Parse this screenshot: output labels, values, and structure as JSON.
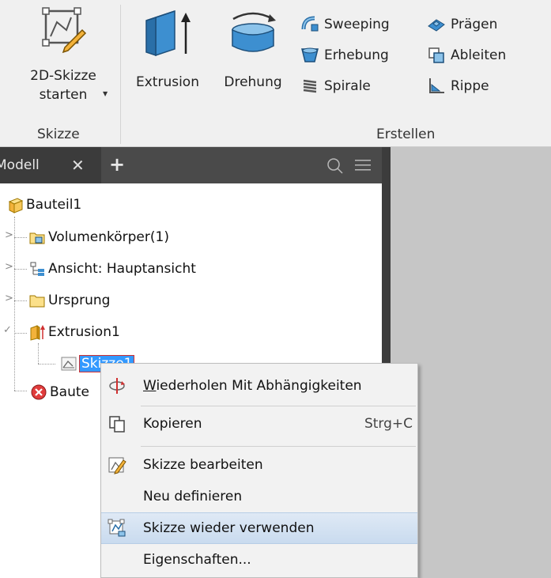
{
  "ribbon": {
    "sketch_button": {
      "line1": "2D-Skizze",
      "line2": "starten",
      "icon": "sketch-2d-icon"
    },
    "extrusion_button": {
      "label": "Extrusion",
      "icon": "extrusion-icon"
    },
    "revolve_button": {
      "label": "Drehung",
      "icon": "revolve-icon"
    },
    "small_buttons": [
      {
        "label": "Sweeping",
        "icon": "sweep-icon"
      },
      {
        "label": "Erhebung",
        "icon": "loft-icon"
      },
      {
        "label": "Spirale",
        "icon": "coil-icon"
      },
      {
        "label": "Prägen",
        "icon": "emboss-icon"
      },
      {
        "label": "Ableiten",
        "icon": "derive-icon"
      },
      {
        "label": "Rippe",
        "icon": "rib-icon"
      }
    ],
    "group_labels": {
      "sketch": "Skizze",
      "create": "Erstellen"
    }
  },
  "browser": {
    "tab_label": "Modell",
    "close_glyph": "✕",
    "add_glyph": "+",
    "tree": {
      "root": "Bauteil1",
      "solid_bodies": "Volumenkörper(1)",
      "view": "Ansicht: Hauptansicht",
      "origin": "Ursprung",
      "extrusion": "Extrusion1",
      "sketch": "Skizze1",
      "end_of_part": "Baute"
    }
  },
  "context_menu": {
    "items": [
      {
        "label": "Wiederholen Mit Abhängigkeiten",
        "shortcut": "",
        "icon": "redo-constraints-icon"
      },
      {
        "label": "Kopieren",
        "shortcut": "Strg+C",
        "icon": "copy-icon"
      },
      {
        "label": "Skizze bearbeiten",
        "shortcut": "",
        "icon": "edit-sketch-icon"
      },
      {
        "label": "Neu definieren",
        "shortcut": "",
        "icon": ""
      },
      {
        "label": "Skizze wieder verwenden",
        "shortcut": "",
        "icon": "reuse-sketch-icon"
      },
      {
        "label": "Eigenschaften...",
        "shortcut": "",
        "icon": ""
      }
    ]
  },
  "colors": {
    "ribbon_bg": "#f0f0f0",
    "panel_header_bg": "#4a4a4a",
    "selection_blue": "#3399ff",
    "menu_highlight": "#c9dbef",
    "workspace_bg": "#c6c6c6"
  }
}
